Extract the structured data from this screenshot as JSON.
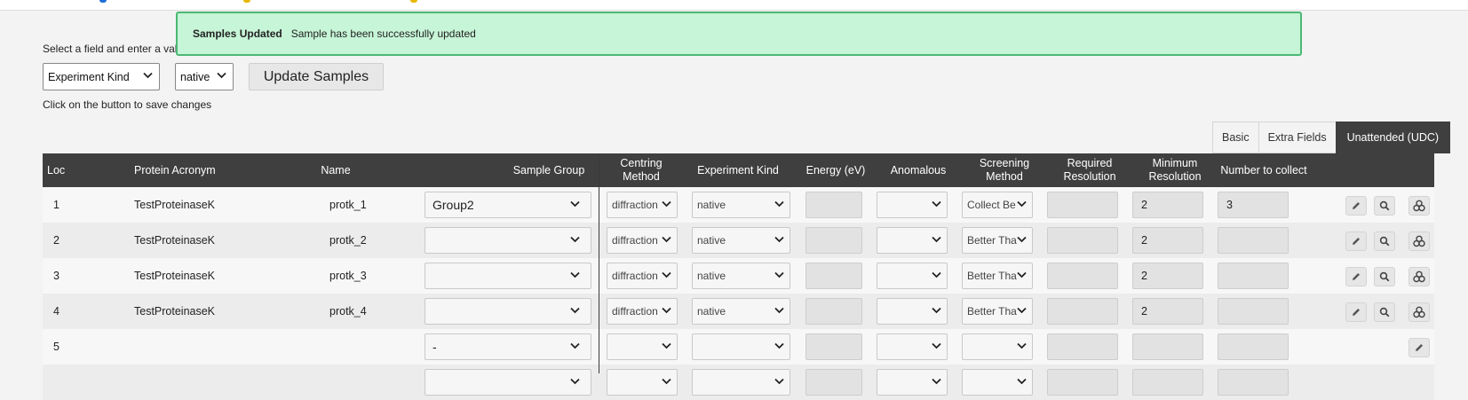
{
  "toast": {
    "title": "Samples Updated",
    "message": "Sample has been successfully updated"
  },
  "controls": {
    "instruction": "Select a field and enter a val",
    "field_select": "Experiment Kind",
    "value_select": "native",
    "update_button": "Update Samples",
    "save_hint": "Click on the button to save changes"
  },
  "tabs": [
    {
      "label": "Basic",
      "active": false
    },
    {
      "label": "Extra Fields",
      "active": false
    },
    {
      "label": "Unattended (UDC)",
      "active": true
    }
  ],
  "table": {
    "headers": {
      "loc": "Loc",
      "protein_acronym": "Protein Acronym",
      "name": "Name",
      "sample_group": "Sample Group",
      "centring_method": "Centring Method",
      "experiment_kind": "Experiment Kind",
      "energy": "Energy (eV)",
      "anomalous": "Anomalous",
      "screening_method": "Screening\nMethod",
      "required_resolution": "Required\nResolution",
      "minimum_resolution": "Minimum\nResolution",
      "number_to_collect": "Number to collect"
    },
    "rows": [
      {
        "loc": "1",
        "protein": "TestProteinaseK",
        "name": "protk_1",
        "group": "Group2",
        "centring": "diffraction",
        "experiment": "native",
        "energy": "",
        "anomalous": "",
        "screening": "Collect Be",
        "required_res": "",
        "minimum_res": "2",
        "number": "3",
        "full_actions": true
      },
      {
        "loc": "2",
        "protein": "TestProteinaseK",
        "name": "protk_2",
        "group": "",
        "centring": "diffraction",
        "experiment": "native",
        "energy": "",
        "anomalous": "",
        "screening": "Better Tha",
        "required_res": "",
        "minimum_res": "2",
        "number": "",
        "full_actions": true
      },
      {
        "loc": "3",
        "protein": "TestProteinaseK",
        "name": "protk_3",
        "group": "",
        "centring": "diffraction",
        "experiment": "native",
        "energy": "",
        "anomalous": "",
        "screening": "Better Tha",
        "required_res": "",
        "minimum_res": "2",
        "number": "",
        "full_actions": true
      },
      {
        "loc": "4",
        "protein": "TestProteinaseK",
        "name": "protk_4",
        "group": "",
        "centring": "diffraction",
        "experiment": "native",
        "energy": "",
        "anomalous": "",
        "screening": "Better Tha",
        "required_res": "",
        "minimum_res": "2",
        "number": "",
        "full_actions": true
      },
      {
        "loc": "5",
        "protein": "",
        "name": "",
        "group": "-",
        "centring": "",
        "experiment": "",
        "energy": "",
        "anomalous": "",
        "screening": "",
        "required_res": "",
        "minimum_res": "",
        "number": "",
        "full_actions": false
      },
      {
        "loc": "",
        "protein": "",
        "name": "",
        "group": "",
        "centring": "",
        "experiment": "",
        "energy": "",
        "anomalous": "",
        "screening": "",
        "required_res": "",
        "minimum_res": "",
        "number": "",
        "full_actions": false
      }
    ]
  },
  "icons": {
    "edit": "pencil-icon",
    "view": "magnifier-icon",
    "containers": "stacked-circles-icon"
  },
  "colors": {
    "header_bg": "#3f3f3f",
    "toast_bg": "#c6f5d7",
    "toast_border": "#4cb874",
    "logo_blue": "#1e6fd9",
    "logo_yellow": "#e8b800"
  }
}
